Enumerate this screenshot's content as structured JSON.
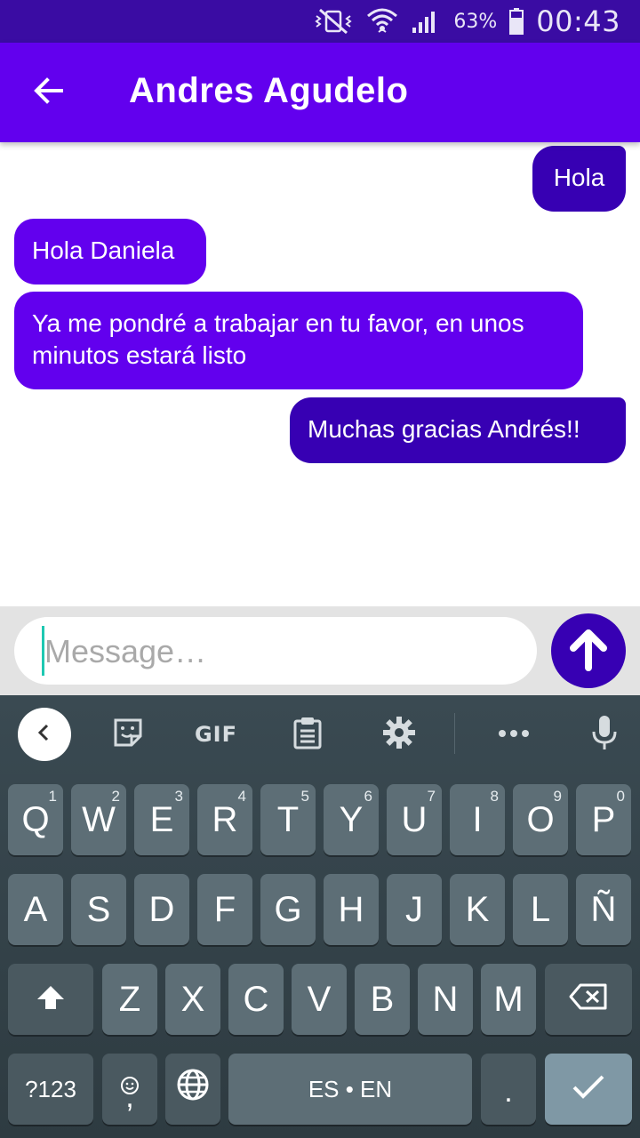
{
  "status_bar": {
    "battery_percent": "63%",
    "time": "00:43",
    "icons": [
      "vibrate-silent-icon",
      "wifi-icon",
      "signal-icon",
      "battery-icon"
    ]
  },
  "app_bar": {
    "title": "Andres Agudelo",
    "back_icon": "arrow-left-icon",
    "color": "#6200ee"
  },
  "messages": [
    {
      "direction": "sent",
      "text": "Hola"
    },
    {
      "direction": "received",
      "text": "Hola Daniela"
    },
    {
      "direction": "received",
      "text": "Ya me pondré a trabajar en tu favor, en unos minutos estará listo"
    },
    {
      "direction": "sent",
      "text": "Muchas gracias Andrés!!"
    }
  ],
  "composer": {
    "placeholder": "Message…",
    "value": "",
    "send_icon": "arrow-up-icon"
  },
  "keyboard": {
    "toolbar": {
      "gif_label": "GIF",
      "icons": [
        "chevron-left-icon",
        "sticker-icon",
        "clipboard-icon",
        "gear-icon",
        "more-horiz-icon",
        "mic-icon"
      ]
    },
    "row1": [
      {
        "label": "Q",
        "hint": "1"
      },
      {
        "label": "W",
        "hint": "2"
      },
      {
        "label": "E",
        "hint": "3"
      },
      {
        "label": "R",
        "hint": "4"
      },
      {
        "label": "T",
        "hint": "5"
      },
      {
        "label": "Y",
        "hint": "6"
      },
      {
        "label": "U",
        "hint": "7"
      },
      {
        "label": "I",
        "hint": "8"
      },
      {
        "label": "O",
        "hint": "9"
      },
      {
        "label": "P",
        "hint": "0"
      }
    ],
    "row2": [
      "A",
      "S",
      "D",
      "F",
      "G",
      "H",
      "J",
      "K",
      "L",
      "Ñ"
    ],
    "row3": [
      "Z",
      "X",
      "C",
      "V",
      "B",
      "N",
      "M"
    ],
    "row4": {
      "symbols_label": "?123",
      "comma_label": ",",
      "space_label": "ES • EN",
      "period_label": "."
    },
    "colors": {
      "key": "#5d6e76",
      "func": "#4a5960",
      "enter": "#7f98a5"
    }
  }
}
